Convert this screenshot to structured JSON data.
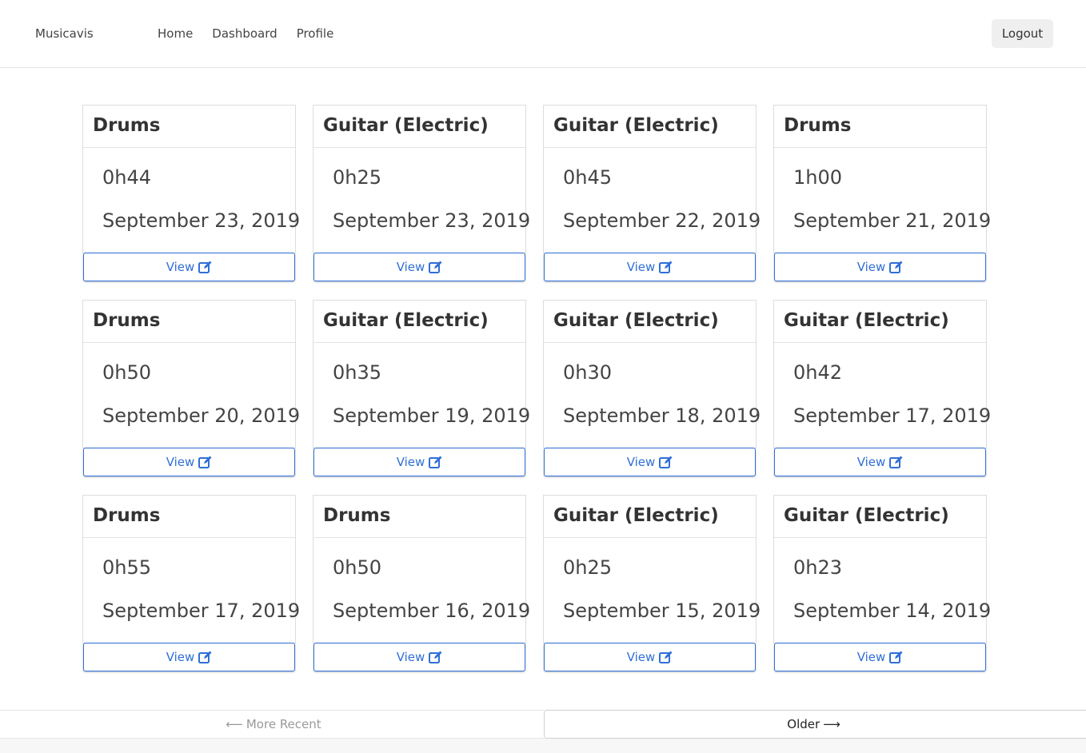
{
  "nav": {
    "brand": "Musicavis",
    "links": [
      "Home",
      "Dashboard",
      "Profile"
    ],
    "logout": "Logout"
  },
  "sessions": [
    {
      "instrument": "Drums",
      "duration": "0h44",
      "date": "September 23, 2019",
      "view_label": "View"
    },
    {
      "instrument": "Guitar (Electric)",
      "duration": "0h25",
      "date": "September 23, 2019",
      "view_label": "View"
    },
    {
      "instrument": "Guitar (Electric)",
      "duration": "0h45",
      "date": "September 22, 2019",
      "view_label": "View"
    },
    {
      "instrument": "Drums",
      "duration": "1h00",
      "date": "September 21, 2019",
      "view_label": "View"
    },
    {
      "instrument": "Drums",
      "duration": "0h50",
      "date": "September 20, 2019",
      "view_label": "View"
    },
    {
      "instrument": "Guitar (Electric)",
      "duration": "0h35",
      "date": "September 19, 2019",
      "view_label": "View"
    },
    {
      "instrument": "Guitar (Electric)",
      "duration": "0h30",
      "date": "September 18, 2019",
      "view_label": "View"
    },
    {
      "instrument": "Guitar (Electric)",
      "duration": "0h42",
      "date": "September 17, 2019",
      "view_label": "View"
    },
    {
      "instrument": "Drums",
      "duration": "0h55",
      "date": "September 17, 2019",
      "view_label": "View"
    },
    {
      "instrument": "Drums",
      "duration": "0h50",
      "date": "September 16, 2019",
      "view_label": "View"
    },
    {
      "instrument": "Guitar (Electric)",
      "duration": "0h25",
      "date": "September 15, 2019",
      "view_label": "View"
    },
    {
      "instrument": "Guitar (Electric)",
      "duration": "0h23",
      "date": "September 14, 2019",
      "view_label": "View"
    }
  ],
  "pagination": {
    "prev_label": "More Recent",
    "next_label": "Older",
    "prev_icon": "arrow-left-icon",
    "next_icon": "arrow-right-icon"
  },
  "colors": {
    "accent": "#2f6fd8",
    "text": "#333333",
    "muted": "#999999"
  }
}
